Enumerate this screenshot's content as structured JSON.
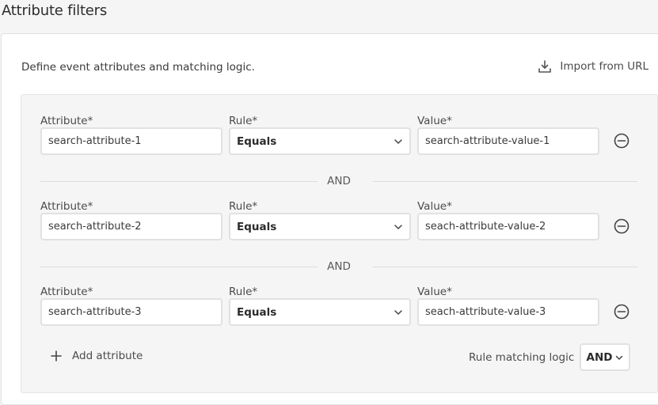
{
  "page": {
    "title": "Attribute filters"
  },
  "card": {
    "description": "Define event attributes and matching logic.",
    "import_label": "Import from URL"
  },
  "rules": [
    {
      "attribute_label": "Attribute*",
      "attribute_value": "search-attribute-1",
      "rule_label": "Rule*",
      "rule_value": "Equals",
      "value_label": "Value*",
      "value_value": "search-attribute-value-1"
    },
    {
      "attribute_label": "Attribute*",
      "attribute_value": "search-attribute-2",
      "rule_label": "Rule*",
      "rule_value": "Equals",
      "value_label": "Value*",
      "value_value": "seach-attribute-value-2"
    },
    {
      "attribute_label": "Attribute*",
      "attribute_value": "search-attribute-3",
      "rule_label": "Rule*",
      "rule_value": "Equals",
      "value_label": "Value*",
      "value_value": "seach-attribute-value-3"
    }
  ],
  "dividers": [
    "AND",
    "AND"
  ],
  "footer": {
    "add_label": "Add attribute",
    "logic_label": "Rule matching logic",
    "logic_value": "AND"
  },
  "icons": {
    "import": "download-icon",
    "remove": "minus-circle-icon",
    "add": "plus-icon",
    "dropdown": "chevron-down-icon"
  },
  "colors": {
    "page_bg": "#f5f5f5",
    "card_bg": "#ffffff",
    "border": "#e1e1e1",
    "text": "#2c2c2c"
  }
}
